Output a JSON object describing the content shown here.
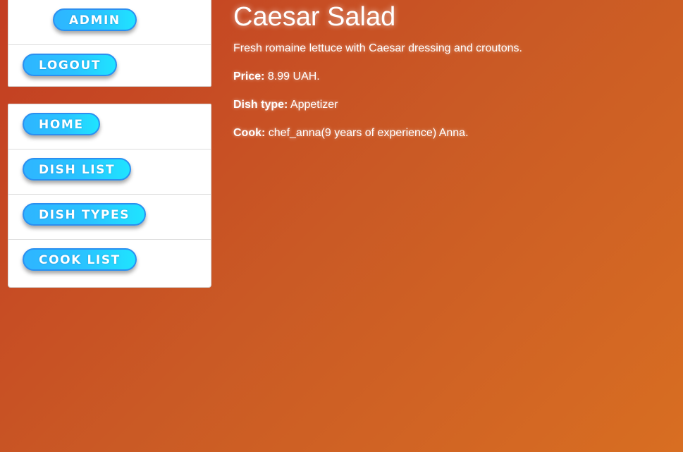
{
  "account_panel": {
    "admin_label": "ADMIN",
    "logout_label": "LOGOUT"
  },
  "nav": {
    "items": [
      {
        "label": "HOME"
      },
      {
        "label": "DISH LIST"
      },
      {
        "label": "DISH TYPES"
      },
      {
        "label": "COOK LIST"
      }
    ]
  },
  "dish": {
    "name": "Caesar Salad",
    "description": "Fresh romaine lettuce with Caesar dressing and croutons.",
    "price_label": "Price:",
    "price_value": "8.99 UAH.",
    "type_label": "Dish type:",
    "type_value": "Appetizer",
    "cook_label": "Cook:",
    "cook_value": "chef_anna(9 years of experience) Anna."
  },
  "colors": {
    "button_gradient_start": "#2eb5ff",
    "button_gradient_end": "#1fe4ff",
    "button_border": "#2b8ff0",
    "background_start": "#c33d22",
    "background_end": "#d86e22"
  }
}
